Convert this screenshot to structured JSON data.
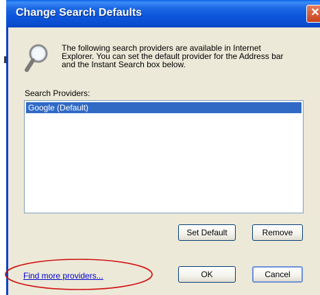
{
  "window": {
    "title": "Change Search Defaults",
    "close_glyph": "✕"
  },
  "description": "The following search providers are available in Internet Explorer.  You can set the default provider for the Address bar and the Instant Search box below.",
  "providers": {
    "label": "Search Providers:",
    "items": [
      {
        "label": "Google (Default)",
        "selected": true
      }
    ]
  },
  "buttons": {
    "set_default": "Set Default",
    "remove": "Remove",
    "ok": "OK",
    "cancel": "Cancel"
  },
  "link": {
    "find_more": "Find more providers..."
  },
  "icons": {
    "search": "search-icon",
    "close": "close-icon"
  },
  "colors": {
    "title_bar": "#0b4fd0",
    "selection": "#316ac5",
    "dialog_background": "#ece9d8",
    "annotation": "#d01010",
    "link": "#0000cc"
  }
}
